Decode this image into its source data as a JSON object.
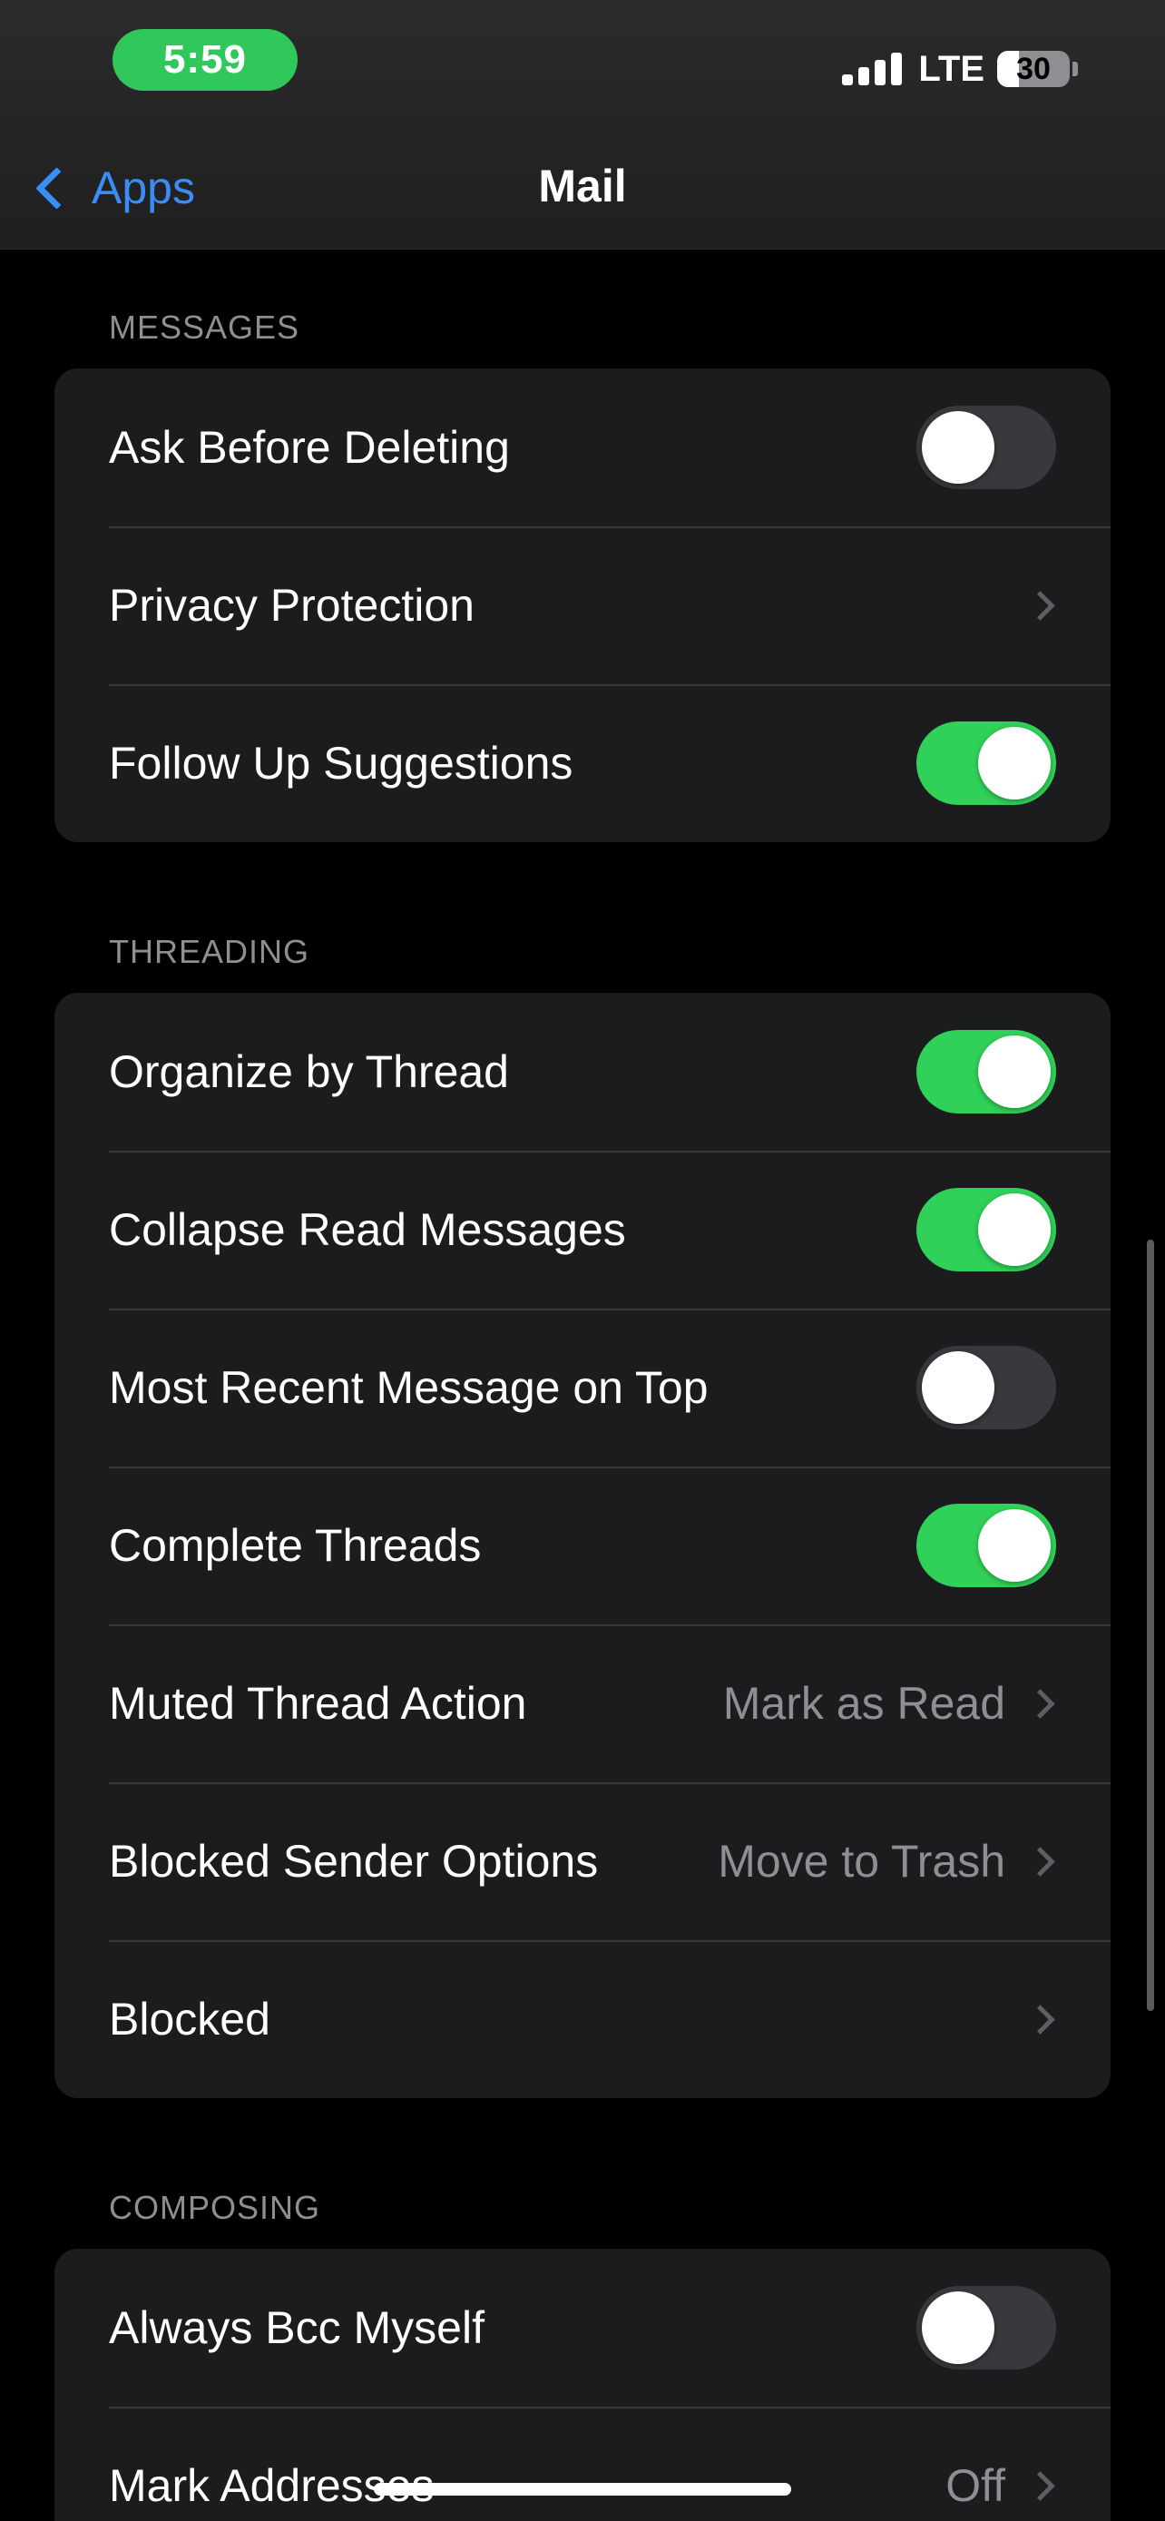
{
  "status_bar": {
    "time": "5:59",
    "network": "LTE",
    "battery_percent": "30",
    "battery_level": 0.3,
    "signal_icon": "signal-bars-icon",
    "time_pill_color": "#30c75b"
  },
  "nav": {
    "back_label": "Apps",
    "title": "Mail",
    "accent_color": "#3a8cf6"
  },
  "sections": [
    {
      "header": "MESSAGES",
      "rows": [
        {
          "label": "Ask Before Deleting",
          "type": "toggle",
          "on": false
        },
        {
          "label": "Privacy Protection",
          "type": "link"
        },
        {
          "label": "Follow Up Suggestions",
          "type": "toggle",
          "on": true
        }
      ]
    },
    {
      "header": "THREADING",
      "rows": [
        {
          "label": "Organize by Thread",
          "type": "toggle",
          "on": true
        },
        {
          "label": "Collapse Read Messages",
          "type": "toggle",
          "on": true
        },
        {
          "label": "Most Recent Message on Top",
          "type": "toggle",
          "on": false
        },
        {
          "label": "Complete Threads",
          "type": "toggle",
          "on": true
        },
        {
          "label": "Muted Thread Action",
          "type": "link",
          "value": "Mark as Read"
        },
        {
          "label": "Blocked Sender Options",
          "type": "link",
          "value": "Move to Trash"
        },
        {
          "label": "Blocked",
          "type": "link"
        }
      ]
    },
    {
      "header": "COMPOSING",
      "rows": [
        {
          "label": "Always Bcc Myself",
          "type": "toggle",
          "on": false
        },
        {
          "label": "Mark Addresses",
          "type": "link",
          "value": "Off"
        }
      ]
    }
  ],
  "colors": {
    "toggle_on": "#30d158",
    "toggle_off": "#39393d",
    "group_background": "#1c1c1e",
    "secondary_text": "#8e8e93"
  }
}
